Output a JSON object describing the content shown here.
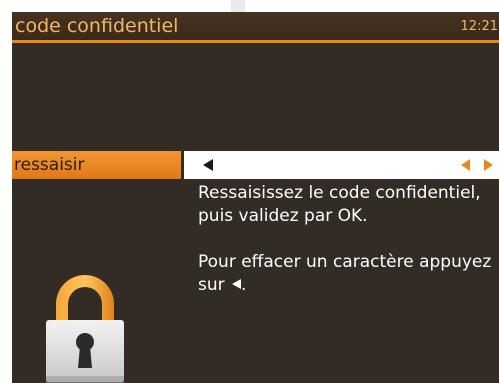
{
  "header": {
    "title": "code confidentiel",
    "clock": "12:21"
  },
  "field": {
    "label": "ressaisir",
    "cursor_icon": "left-triangle-icon",
    "nav_icons": [
      "left-arrow-icon",
      "right-arrow-icon"
    ]
  },
  "instructions": {
    "paragraph1": "Ressaisissez le code confidentiel, puis validez par OK.",
    "paragraph2_text": "Pour effacer un caractère appuyez sur",
    "paragraph2_icon": "left-triangle-icon",
    "paragraph2_end": "."
  },
  "lock_icon": "padlock-icon",
  "colors": {
    "background": "#332c25",
    "accent": "#e8871c",
    "header_text": "#f4b567",
    "text": "#ffffff"
  }
}
